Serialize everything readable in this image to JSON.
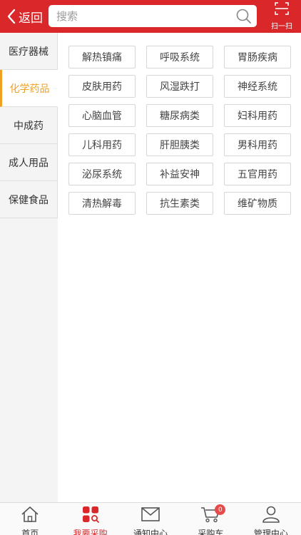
{
  "header": {
    "back_label": "返回",
    "search_placeholder": "搜索",
    "scan_label": "扫一扫"
  },
  "sidebar": {
    "items": [
      {
        "label": "医疗器械",
        "active": false
      },
      {
        "label": "化学药品",
        "active": true
      },
      {
        "label": "中成药",
        "active": false
      },
      {
        "label": "成人用品",
        "active": false
      },
      {
        "label": "保健食品",
        "active": false
      }
    ]
  },
  "categories": [
    "解热镇痛",
    "呼吸系统",
    "胃肠疾病",
    "皮肤用药",
    "风湿跌打",
    "神经系统",
    "心脑血管",
    "糖尿病类",
    "妇科用药",
    "儿科用药",
    "肝胆胰类",
    "男科用药",
    "泌尿系统",
    "补益安神",
    "五官用药",
    "清热解毒",
    "抗生素类",
    "维矿物质"
  ],
  "tabbar": {
    "items": [
      {
        "label": "首页",
        "icon": "home-icon"
      },
      {
        "label": "我要采购",
        "icon": "purchase-icon",
        "active": true
      },
      {
        "label": "通知中心",
        "icon": "mail-icon"
      },
      {
        "label": "采购车",
        "icon": "cart-icon",
        "badge": "0"
      },
      {
        "label": "管理中心",
        "icon": "user-icon"
      }
    ]
  },
  "colors": {
    "brand_red": "#d9272a",
    "active_orange": "#f0a020"
  }
}
